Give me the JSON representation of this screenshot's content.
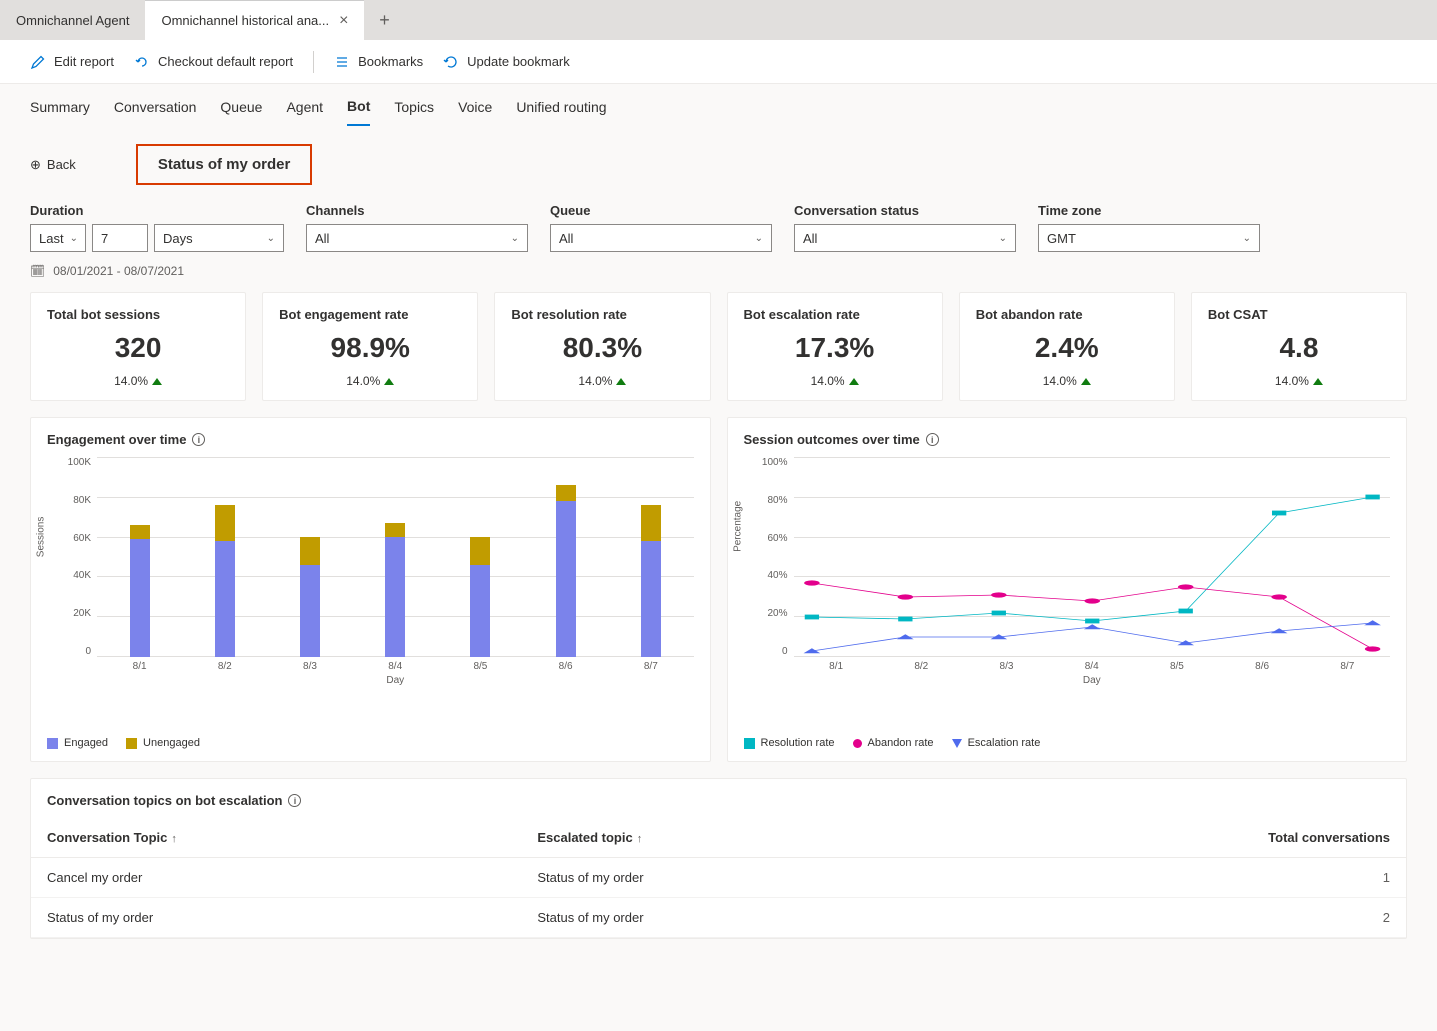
{
  "tabs": {
    "inactive": "Omnichannel Agent",
    "active": "Omnichannel historical ana..."
  },
  "toolbar": {
    "edit": "Edit report",
    "checkout": "Checkout default report",
    "bookmarks": "Bookmarks",
    "update": "Update bookmark"
  },
  "nav": {
    "items": [
      "Summary",
      "Conversation",
      "Queue",
      "Agent",
      "Bot",
      "Topics",
      "Voice",
      "Unified routing"
    ],
    "active": "Bot"
  },
  "header": {
    "back": "Back",
    "topic_title": "Status of my order"
  },
  "filters": {
    "duration_label": "Duration",
    "duration_last": "Last",
    "duration_n": "7",
    "duration_unit": "Days",
    "channels_label": "Channels",
    "channels_value": "All",
    "queue_label": "Queue",
    "queue_value": "All",
    "status_label": "Conversation status",
    "status_value": "All",
    "tz_label": "Time zone",
    "tz_value": "GMT",
    "date_range": "08/01/2021 - 08/07/2021"
  },
  "kpis": [
    {
      "title": "Total bot sessions",
      "value": "320",
      "delta": "14.0%"
    },
    {
      "title": "Bot engagement rate",
      "value": "98.9%",
      "delta": "14.0%"
    },
    {
      "title": "Bot resolution rate",
      "value": "80.3%",
      "delta": "14.0%"
    },
    {
      "title": "Bot escalation rate",
      "value": "17.3%",
      "delta": "14.0%"
    },
    {
      "title": "Bot abandon rate",
      "value": "2.4%",
      "delta": "14.0%"
    },
    {
      "title": "Bot CSAT",
      "value": "4.8",
      "delta": "14.0%"
    }
  ],
  "chart_data": [
    {
      "type": "bar",
      "title": "Engagement over time",
      "xlabel": "Day",
      "ylabel": "Sessions",
      "ylim": [
        0,
        100000
      ],
      "yticks": [
        "100K",
        "80K",
        "60K",
        "40K",
        "20K",
        "0"
      ],
      "categories": [
        "8/1",
        "8/2",
        "8/3",
        "8/4",
        "8/5",
        "8/6",
        "8/7"
      ],
      "series": [
        {
          "name": "Engaged",
          "color": "#7b83eb",
          "values": [
            59000,
            58000,
            46000,
            60000,
            46000,
            78000,
            58000
          ]
        },
        {
          "name": "Unengaged",
          "color": "#c19c00",
          "values": [
            7000,
            18000,
            14000,
            7000,
            14000,
            8000,
            18000
          ]
        }
      ],
      "legend": [
        "Engaged",
        "Unengaged"
      ]
    },
    {
      "type": "line",
      "title": "Session outcomes over time",
      "xlabel": "Day",
      "ylabel": "Percentage",
      "ylim": [
        0,
        100
      ],
      "yticks": [
        "100%",
        "80%",
        "60%",
        "40%",
        "20%",
        "0"
      ],
      "categories": [
        "8/1",
        "8/2",
        "8/3",
        "8/4",
        "8/5",
        "8/6",
        "8/7"
      ],
      "series": [
        {
          "name": "Resolution rate",
          "color": "#00b7c3",
          "marker": "square",
          "values": [
            20,
            19,
            22,
            18,
            23,
            72,
            80
          ]
        },
        {
          "name": "Abandon rate",
          "color": "#e3008c",
          "marker": "circle",
          "values": [
            37,
            30,
            31,
            28,
            35,
            30,
            4
          ]
        },
        {
          "name": "Escalation rate",
          "color": "#4f6bed",
          "marker": "triangle",
          "values": [
            3,
            10,
            10,
            15,
            7,
            13,
            17
          ]
        }
      ],
      "legend": [
        "Resolution rate",
        "Abandon rate",
        "Escalation rate"
      ]
    }
  ],
  "table": {
    "title": "Conversation topics on bot escalation",
    "columns": [
      "Conversation Topic",
      "Escalated topic",
      "Total conversations"
    ],
    "rows": [
      {
        "topic": "Cancel my order",
        "escalated": "Status of my order",
        "total": "1"
      },
      {
        "topic": "Status of my order",
        "escalated": "Status of my order",
        "total": "2"
      }
    ]
  }
}
